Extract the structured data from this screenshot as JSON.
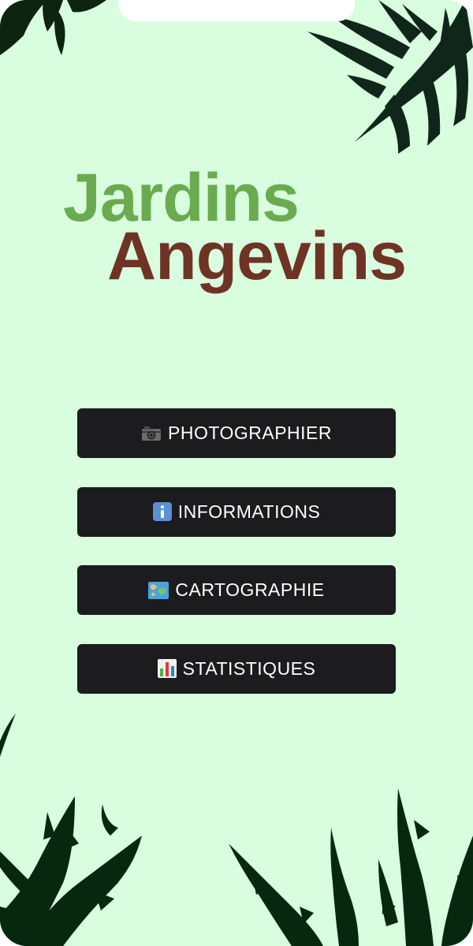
{
  "app": {
    "title_line1": "Jardins",
    "title_line2": "Angevins"
  },
  "menu": {
    "items": [
      {
        "label": "PHOTOGRAPHIER",
        "icon": "camera-icon"
      },
      {
        "label": "INFORMATIONS",
        "icon": "info-icon"
      },
      {
        "label": "CARTOGRAPHIE",
        "icon": "map-icon"
      },
      {
        "label": "STATISTIQUES",
        "icon": "bar-chart-icon"
      }
    ]
  },
  "colors": {
    "background": "#d8fddf",
    "title_green": "#6aab4f",
    "title_brown": "#6e3325",
    "button_bg": "#1c1c1e",
    "button_text": "#ffffff",
    "leaf": "#0f2a14"
  }
}
